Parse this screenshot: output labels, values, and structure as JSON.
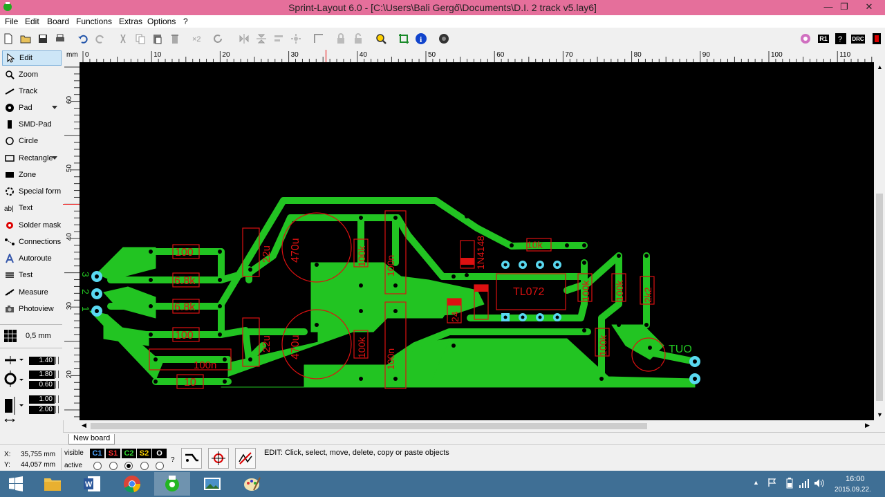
{
  "window": {
    "title": "Sprint-Layout 6.0 - [C:\\Users\\Bali Gergő\\Documents\\D.I. 2 track v5.lay6]",
    "minimize": "—",
    "maximize": "❐",
    "close": "✕"
  },
  "menu": [
    "File",
    "Edit",
    "Board",
    "Functions",
    "Extras",
    "Options",
    "?"
  ],
  "toolbar": {
    "left_icons": [
      "new-icon",
      "open-icon",
      "save-icon",
      "print-icon",
      "undo-icon",
      "redo-icon",
      "cut-icon",
      "copy-icon",
      "paste-icon",
      "delete-icon",
      "duplicate-x2-icon",
      "rotate-icon",
      "mirror-h-icon",
      "mirror-v-icon",
      "align-icon",
      "group-icon",
      "snap-icon",
      "lock-icon",
      "unlock-icon",
      "zoom-icon",
      "fit-icon",
      "info-icon",
      "components-icon"
    ],
    "right_badges": [
      "R1",
      "DRC"
    ]
  },
  "tools": [
    {
      "label": "Edit",
      "icon": "cursor-icon",
      "active": true
    },
    {
      "label": "Zoom",
      "icon": "magnifier-icon"
    },
    {
      "label": "Track",
      "icon": "track-icon"
    },
    {
      "label": "Pad",
      "icon": "pad-icon",
      "dropdown": true
    },
    {
      "label": "SMD-Pad",
      "icon": "smd-pad-icon"
    },
    {
      "label": "Circle",
      "icon": "circle-icon"
    },
    {
      "label": "Rectangle",
      "icon": "rectangle-icon",
      "dropdown": true
    },
    {
      "label": "Zone",
      "icon": "zone-icon"
    },
    {
      "label": "Special form",
      "icon": "special-form-icon"
    },
    {
      "label": "Text",
      "icon": "text-icon"
    },
    {
      "label": "Solder mask",
      "icon": "solder-mask-icon"
    },
    {
      "label": "Connections",
      "icon": "connections-icon"
    },
    {
      "label": "Autoroute",
      "icon": "autoroute-icon"
    },
    {
      "label": "Test",
      "icon": "test-icon"
    },
    {
      "label": "Measure",
      "icon": "measure-icon"
    },
    {
      "label": "Photoview",
      "icon": "photoview-icon"
    }
  ],
  "grid": {
    "label": "0,5 mm"
  },
  "params": {
    "track_width": "1.40",
    "pad_outer": "1.80",
    "pad_inner": "0.60",
    "smd_w": "1.00",
    "smd_h": "2.00"
  },
  "ruler": {
    "unit": "mm",
    "top_ticks": [
      "0",
      "10",
      "20",
      "30",
      "40",
      "50",
      "60",
      "70",
      "80",
      "90",
      "100",
      "110"
    ],
    "left_ticks": [
      "60",
      "50",
      "40",
      "30",
      "20"
    ]
  },
  "board": {
    "component_labels": [
      "100",
      "6.8k",
      "6.8k",
      "100",
      "100n",
      "10",
      "22u",
      "22u",
      "470u",
      "470u",
      "100k",
      "100k",
      "100n",
      "100n",
      "1N4148",
      "24",
      "TL072",
      "10k",
      "100k",
      "100k",
      "100k",
      "2k2",
      "TUO"
    ],
    "connector_labels": [
      "3",
      "2",
      "1"
    ],
    "colors": {
      "copper": "#22c422",
      "silk": "#dd1111",
      "pad": "#59d8f0",
      "background": "#000000"
    }
  },
  "tabs": {
    "active": "New board"
  },
  "status": {
    "x_label": "X:",
    "x_value": "35,755 mm",
    "y_label": "Y:",
    "y_value": "44,057 mm",
    "visible_label": "visible",
    "active_label": "active",
    "layers": [
      "C1",
      "S1",
      "C2",
      "S2",
      "O"
    ],
    "active_layer_index": 2,
    "question": "?",
    "message": "EDIT:  Click, select, move, delete, copy or paste objects"
  },
  "taskbar": {
    "apps": [
      "start-icon",
      "file-explorer-icon",
      "word-icon",
      "chrome-icon",
      "sprint-layout-icon",
      "photo-viewer-icon",
      "paint-icon"
    ],
    "time": "16:00",
    "date": "2015.09.22."
  }
}
